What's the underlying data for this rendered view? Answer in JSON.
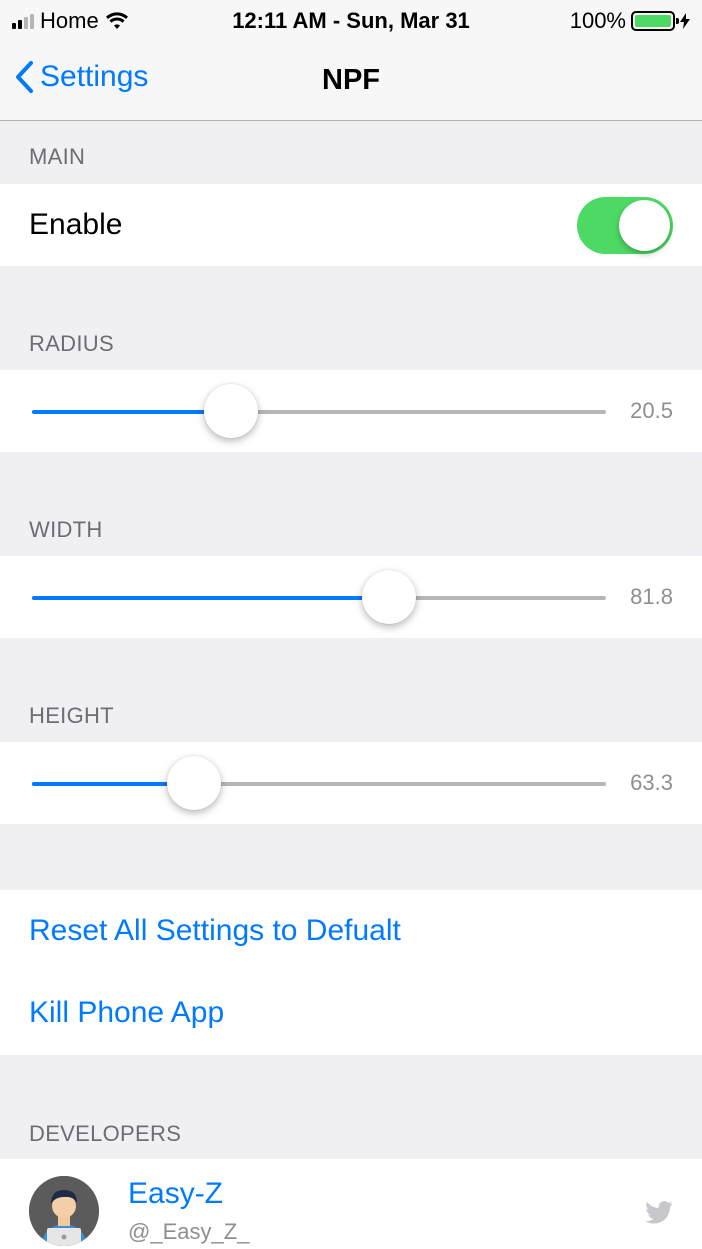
{
  "status_bar": {
    "carrier": "Home",
    "time": "12:11 AM - Sun, Mar 31",
    "battery": "100%",
    "battery_level": 1.0
  },
  "nav": {
    "back_label": "Settings",
    "title": "NPF"
  },
  "sections": {
    "main": {
      "header": "MAIN",
      "enable_label": "Enable",
      "enable_on": true
    },
    "radius": {
      "header": "RADIUS",
      "value": "20.5",
      "fraction": 0.347
    },
    "width": {
      "header": "WIDTH",
      "value": "81.8",
      "fraction": 0.622
    },
    "height": {
      "header": "HEIGHT",
      "value": "63.3",
      "fraction": 0.283
    },
    "actions": {
      "reset_label": "Reset All Settings to Defualt",
      "kill_label": "Kill Phone App"
    },
    "developers": {
      "header": "DEVELOPERS",
      "name": "Easy-Z",
      "handle": "@_Easy_Z_",
      "icon": "twitter-icon"
    }
  },
  "colors": {
    "accent": "#007aff",
    "toggle_on": "#4cd964",
    "background": "#efeff4"
  }
}
